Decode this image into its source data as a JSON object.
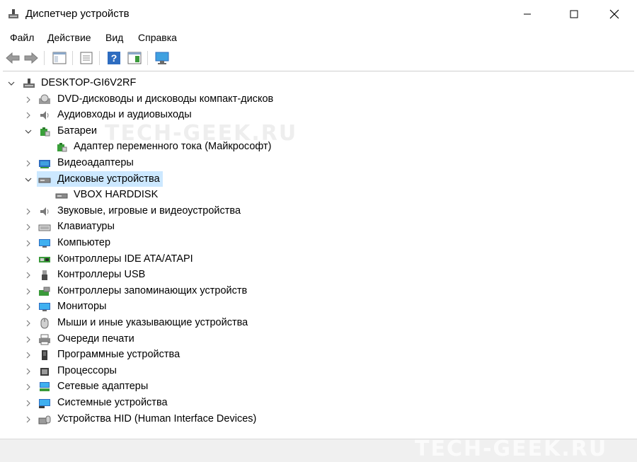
{
  "window": {
    "title": "Диспетчер устройств"
  },
  "menu": [
    {
      "label": "Файл"
    },
    {
      "label": "Действие"
    },
    {
      "label": "Вид"
    },
    {
      "label": "Справка"
    }
  ],
  "tree": {
    "root": "DESKTOP-GI6V2RF",
    "categories": [
      {
        "label": "DVD-дисководы и дисководы компакт-дисков",
        "icon": "dvd-drive-icon",
        "expanded": false
      },
      {
        "label": "Аудиовходы и аудиовыходы",
        "icon": "speaker-icon",
        "expanded": false
      },
      {
        "label": "Батареи",
        "icon": "battery-icon",
        "expanded": true
      },
      {
        "label": "Адаптер переменного тока (Майкрософт)",
        "icon": "battery-icon",
        "child": true
      },
      {
        "label": "Видеоадаптеры",
        "icon": "display-adapter-icon",
        "expanded": false
      },
      {
        "label": "Дисковые устройства",
        "icon": "disk-drive-icon",
        "expanded": true,
        "selected": true
      },
      {
        "label": "VBOX HARDDISK",
        "icon": "disk-drive-icon",
        "child": true
      },
      {
        "label": "Звуковые, игровые и видеоустройства",
        "icon": "speaker-icon",
        "expanded": false
      },
      {
        "label": "Клавиатуры",
        "icon": "keyboard-icon",
        "expanded": false
      },
      {
        "label": "Компьютер",
        "icon": "monitor-icon",
        "expanded": false
      },
      {
        "label": "Контроллеры IDE ATA/ATAPI",
        "icon": "ide-controller-icon",
        "expanded": false
      },
      {
        "label": "Контроллеры USB",
        "icon": "usb-icon",
        "expanded": false
      },
      {
        "label": "Контроллеры запоминающих устройств",
        "icon": "storage-controller-icon",
        "expanded": false
      },
      {
        "label": "Мониторы",
        "icon": "monitor-icon",
        "expanded": false
      },
      {
        "label": "Мыши и иные указывающие устройства",
        "icon": "mouse-icon",
        "expanded": false
      },
      {
        "label": "Очереди печати",
        "icon": "printer-icon",
        "expanded": false
      },
      {
        "label": "Программные устройства",
        "icon": "software-device-icon",
        "expanded": false
      },
      {
        "label": "Процессоры",
        "icon": "cpu-icon",
        "expanded": false
      },
      {
        "label": "Сетевые адаптеры",
        "icon": "network-adapter-icon",
        "expanded": false
      },
      {
        "label": "Системные устройства",
        "icon": "system-device-icon",
        "expanded": false
      },
      {
        "label": "Устройства HID (Human Interface Devices)",
        "icon": "hid-icon",
        "expanded": false
      }
    ]
  },
  "watermark": "TECH-GEEK.RU",
  "colors": {
    "selection": "#cce8ff",
    "statusbar": "#f0f0f0"
  }
}
